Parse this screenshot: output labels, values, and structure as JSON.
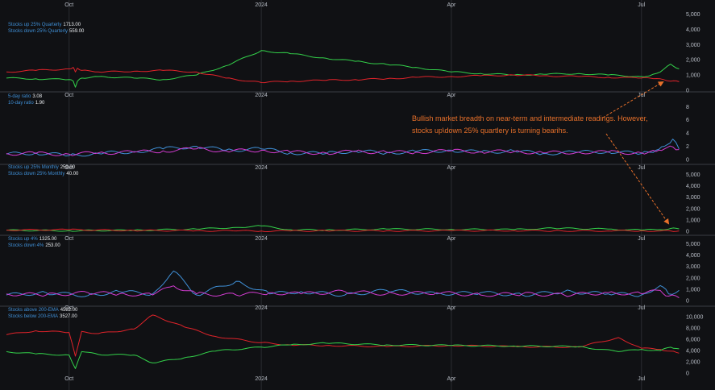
{
  "axis": {
    "x_ticks": [
      "Oct",
      "2024",
      "Apr",
      "Jul"
    ]
  },
  "annotation": {
    "text": "Bullish market breadth on near-term and intermediate readings.  However, stocks up\\down 25% quartlery is turning bearihs."
  },
  "colors": {
    "background": "#101114",
    "grid": "#2a2c31",
    "separator": "#3a3d44",
    "green": "#33d14a",
    "red": "#e0232a",
    "blue": "#3f8fd6",
    "magenta": "#d23bd0",
    "annotation": "#e8702a",
    "legend_label": "#3f8fd6",
    "legend_value": "#e9ecef"
  },
  "chart_data": [
    {
      "type": "line",
      "legend": [
        {
          "label": "Stocks up 25% Quarterly",
          "value": "1713.00"
        },
        {
          "label": "Stocks down 25% Quarterly",
          "value": "559.00"
        }
      ],
      "y_ticks": [
        "0",
        "1,000",
        "2,000",
        "3,000",
        "4,000",
        "5,000"
      ],
      "ylim": [
        0,
        5500
      ],
      "x": [
        "2023-09-01",
        "2023-09-15",
        "2023-10-01",
        "2023-10-03",
        "2023-10-04",
        "2023-10-05",
        "2023-10-07",
        "2023-10-15",
        "2023-11-01",
        "2023-11-15",
        "2023-12-01",
        "2023-12-15",
        "2024-01-01",
        "2024-01-15",
        "2024-02-01",
        "2024-02-15",
        "2024-03-01",
        "2024-03-15",
        "2024-04-01",
        "2024-04-15",
        "2024-05-01",
        "2024-05-15",
        "2024-06-01",
        "2024-06-15",
        "2024-07-01",
        "2024-07-05",
        "2024-07-10",
        "2024-07-15",
        "2024-07-19"
      ],
      "series": [
        {
          "color": "#33d14a",
          "values": [
            800,
            750,
            700,
            600,
            200,
            600,
            800,
            900,
            800,
            700,
            1000,
            1600,
            2600,
            2400,
            2100,
            1900,
            1700,
            1500,
            1200,
            1100,
            1000,
            1050,
            1100,
            1000,
            900,
            950,
            1200,
            1713,
            1400
          ]
        },
        {
          "color": "#e0232a",
          "values": [
            1200,
            1300,
            1400,
            1500,
            1200,
            1450,
            1300,
            1200,
            1250,
            1300,
            1200,
            800,
            500,
            600,
            650,
            700,
            750,
            850,
            900,
            950,
            1000,
            950,
            900,
            850,
            800,
            800,
            750,
            600,
            559
          ]
        }
      ]
    },
    {
      "type": "line",
      "legend": [
        {
          "label": "5-day ratio",
          "value": "3.08"
        },
        {
          "label": "10-day ratio",
          "value": "1.90"
        }
      ],
      "y_ticks": [
        "0",
        "2",
        "4",
        "6",
        "8"
      ],
      "ylim": [
        -0.5,
        9.5
      ],
      "x": [
        "2023-09-01",
        "2023-09-15",
        "2023-10-01",
        "2023-10-15",
        "2023-11-01",
        "2023-11-15",
        "2023-12-01",
        "2023-12-15",
        "2024-01-01",
        "2024-01-15",
        "2024-02-01",
        "2024-02-15",
        "2024-03-01",
        "2024-03-15",
        "2024-04-01",
        "2024-04-15",
        "2024-05-01",
        "2024-05-15",
        "2024-06-01",
        "2024-06-15",
        "2024-07-01",
        "2024-07-08",
        "2024-07-12",
        "2024-07-16",
        "2024-07-19"
      ],
      "series": [
        {
          "color": "#3f8fd6",
          "values": [
            0.8,
            1.0,
            0.6,
            0.9,
            1.2,
            1.6,
            2.0,
            1.4,
            1.6,
            1.0,
            0.9,
            1.3,
            1.0,
            1.2,
            1.4,
            1.1,
            1.3,
            0.9,
            1.1,
            1.2,
            0.9,
            1.4,
            2.0,
            3.08,
            1.6
          ]
        },
        {
          "color": "#d23bd0",
          "values": [
            0.9,
            0.9,
            0.8,
            1.0,
            1.1,
            1.3,
            1.6,
            1.3,
            1.4,
            1.1,
            1.0,
            1.2,
            1.1,
            1.1,
            1.3,
            1.2,
            1.2,
            1.0,
            1.1,
            1.1,
            1.0,
            1.2,
            1.6,
            1.9,
            1.5
          ]
        }
      ]
    },
    {
      "type": "line",
      "legend": [
        {
          "label": "Stocks up 25% Monthly",
          "value": "259.00"
        },
        {
          "label": "Stocks down 25% Monthly",
          "value": "40.00"
        }
      ],
      "y_ticks": [
        "0",
        "1,000",
        "2,000",
        "3,000",
        "4,000",
        "5,000"
      ],
      "ylim": [
        -200,
        5300
      ],
      "x": [
        "2023-09-01",
        "2023-10-01",
        "2023-11-01",
        "2023-12-01",
        "2023-12-20",
        "2024-01-01",
        "2024-01-15",
        "2024-02-01",
        "2024-03-01",
        "2024-04-01",
        "2024-05-01",
        "2024-05-20",
        "2024-06-15",
        "2024-07-01",
        "2024-07-10",
        "2024-07-15",
        "2024-07-19"
      ],
      "series": [
        {
          "color": "#33d14a",
          "values": [
            100,
            60,
            100,
            200,
            350,
            480,
            150,
            120,
            200,
            180,
            160,
            280,
            200,
            120,
            150,
            259,
            220
          ]
        },
        {
          "color": "#e0232a",
          "values": [
            120,
            150,
            80,
            60,
            40,
            30,
            40,
            60,
            50,
            60,
            70,
            50,
            40,
            60,
            40,
            40,
            40
          ]
        }
      ]
    },
    {
      "type": "line",
      "legend": [
        {
          "label": "Stocks up 4%",
          "value": "1325.00"
        },
        {
          "label": "Stocks down 4%",
          "value": "253.00"
        }
      ],
      "y_ticks": [
        "0",
        "1,000",
        "2,000",
        "3,000",
        "4,000",
        "5,000"
      ],
      "ylim": [
        -200,
        5300
      ],
      "x": [
        "2023-09-01",
        "2023-09-20",
        "2023-10-10",
        "2023-10-25",
        "2023-11-10",
        "2023-11-20",
        "2023-12-01",
        "2023-12-20",
        "2024-01-05",
        "2024-01-20",
        "2024-02-10",
        "2024-03-01",
        "2024-03-25",
        "2024-04-15",
        "2024-05-05",
        "2024-05-25",
        "2024-06-15",
        "2024-07-01",
        "2024-07-10",
        "2024-07-14",
        "2024-07-19"
      ],
      "series": [
        {
          "color": "#3f8fd6",
          "values": [
            500,
            700,
            450,
            800,
            600,
            2600,
            500,
            1700,
            600,
            800,
            500,
            900,
            600,
            700,
            500,
            800,
            600,
            500,
            1325,
            600,
            900
          ]
        },
        {
          "color": "#d23bd0",
          "values": [
            600,
            500,
            700,
            600,
            500,
            1300,
            600,
            500,
            700,
            600,
            800,
            600,
            700,
            500,
            600,
            500,
            700,
            600,
            900,
            400,
            253
          ]
        }
      ]
    },
    {
      "type": "line",
      "legend": [
        {
          "label": "Stocks above 200-EMA",
          "value": "4582.00"
        },
        {
          "label": "Stocks below 200-EMA",
          "value": "3527.00"
        }
      ],
      "y_ticks": [
        "0",
        "2,000",
        "4,000",
        "6,000",
        "8,000",
        "10,000"
      ],
      "ylim": [
        -1000,
        11000
      ],
      "x": [
        "2023-09-01",
        "2023-09-15",
        "2023-10-01",
        "2023-10-04",
        "2023-10-07",
        "2023-10-15",
        "2023-11-01",
        "2023-11-10",
        "2023-11-25",
        "2023-12-10",
        "2024-01-01",
        "2024-01-15",
        "2024-02-01",
        "2024-03-01",
        "2024-04-01",
        "2024-05-01",
        "2024-06-01",
        "2024-06-20",
        "2024-07-01",
        "2024-07-10",
        "2024-07-15",
        "2024-07-19"
      ],
      "series": [
        {
          "color": "#e0232a",
          "values": [
            6800,
            7500,
            7200,
            3000,
            7400,
            7000,
            7800,
            10300,
            8200,
            6500,
            5400,
            5000,
            4900,
            4700,
            4900,
            4700,
            4600,
            6300,
            4400,
            4200,
            3900,
            3527
          ]
        },
        {
          "color": "#33d14a",
          "values": [
            3800,
            3400,
            3200,
            800,
            3800,
            3300,
            3200,
            1800,
            2700,
            3900,
            4600,
            5000,
            5300,
            5000,
            4900,
            4800,
            4700,
            3800,
            4200,
            4000,
            4582,
            4300
          ]
        }
      ]
    }
  ]
}
